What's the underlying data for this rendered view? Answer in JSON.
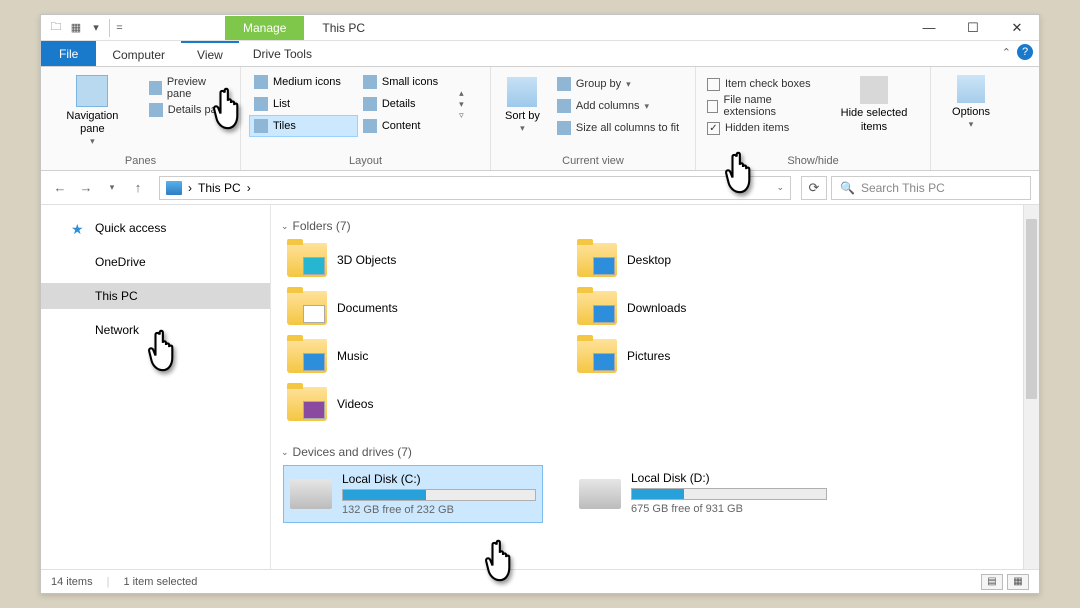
{
  "title": "This PC",
  "titlebar": {
    "manage": "Manage"
  },
  "menubar": {
    "file": "File",
    "tabs": [
      "Computer",
      "View"
    ],
    "drive_tools": "Drive Tools"
  },
  "ribbon": {
    "panes": {
      "label": "Panes",
      "nav": "Navigation pane",
      "preview": "Preview pane",
      "details": "Details pane"
    },
    "layout": {
      "label": "Layout",
      "items": [
        [
          "Medium icons",
          "Small icons"
        ],
        [
          "List",
          "Details"
        ],
        [
          "Tiles",
          "Content"
        ]
      ],
      "selected": "Tiles"
    },
    "currentview": {
      "label": "Current view",
      "sort": "Sort by",
      "group": "Group by",
      "addcols": "Add columns",
      "sizecols": "Size all columns to fit"
    },
    "showhide": {
      "label": "Show/hide",
      "item_check": "Item check boxes",
      "file_ext": "File name extensions",
      "hidden": "Hidden items",
      "hide_sel": "Hide selected items"
    },
    "options": "Options"
  },
  "address": {
    "path": "This PC",
    "sep": "›"
  },
  "search": {
    "placeholder": "Search This PC"
  },
  "sidebar": {
    "items": [
      {
        "label": "Quick access",
        "id": "quick-access"
      },
      {
        "label": "OneDrive",
        "id": "onedrive"
      },
      {
        "label": "This PC",
        "id": "this-pc"
      },
      {
        "label": "Network",
        "id": "network"
      }
    ]
  },
  "sections": {
    "folders": {
      "header": "Folders (7)"
    },
    "drives": {
      "header": "Devices and drives (7)"
    }
  },
  "folders": [
    {
      "name": "3D Objects"
    },
    {
      "name": "Desktop"
    },
    {
      "name": "Documents"
    },
    {
      "name": "Downloads"
    },
    {
      "name": "Music"
    },
    {
      "name": "Pictures"
    },
    {
      "name": "Videos"
    }
  ],
  "drives": [
    {
      "name": "Local Disk (C:)",
      "free": "132 GB free of 232 GB",
      "fill_pct": 43,
      "selected": true
    },
    {
      "name": "Local Disk (D:)",
      "free": "675 GB free of 931 GB",
      "fill_pct": 27,
      "selected": false
    }
  ],
  "status": {
    "count": "14 items",
    "selected": "1 item selected"
  }
}
